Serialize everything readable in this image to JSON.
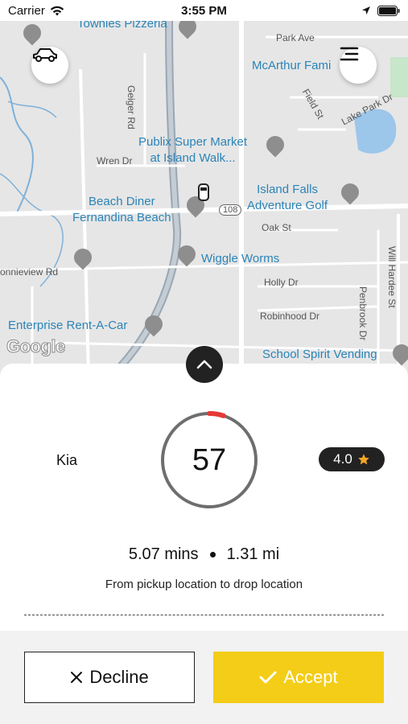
{
  "status_bar": {
    "carrier": "Carrier",
    "time": "3:55 PM"
  },
  "map": {
    "streets": [
      "Geiger Rd",
      "Park Ave",
      "Wren Dr",
      "Oak St",
      "Holly Dr",
      "Robinhood Dr",
      "Field St",
      "Lake Park Dr",
      "Penbrook Dr",
      "Will Hardee St",
      "onnieview Rd",
      "108"
    ],
    "places": [
      {
        "name": "Townies Pizzeria"
      },
      {
        "name": "McArthur Fami"
      },
      {
        "name": "Publix Super Market\nat Island Walk..."
      },
      {
        "name": "Beach Diner\nFernandina Beach"
      },
      {
        "name": "Island Falls\nAdventure Golf"
      },
      {
        "name": "Wiggle Worms"
      },
      {
        "name": "Enterprise Rent-A-Car"
      },
      {
        "name": "School Spirit Vending"
      }
    ],
    "attribution": "Google"
  },
  "ride_request": {
    "vehicle": "Kia",
    "countdown": "57",
    "countdown_progress": 0.05,
    "rating": "4.0",
    "duration": "5.07 mins",
    "distance": "1.31 mi",
    "description": "From pickup location to drop location"
  },
  "actions": {
    "decline_label": "Decline",
    "accept_label": "Accept"
  },
  "colors": {
    "accept": "#f3cd17",
    "ring_progress": "#e53935",
    "rating_star": "#f5a623"
  }
}
